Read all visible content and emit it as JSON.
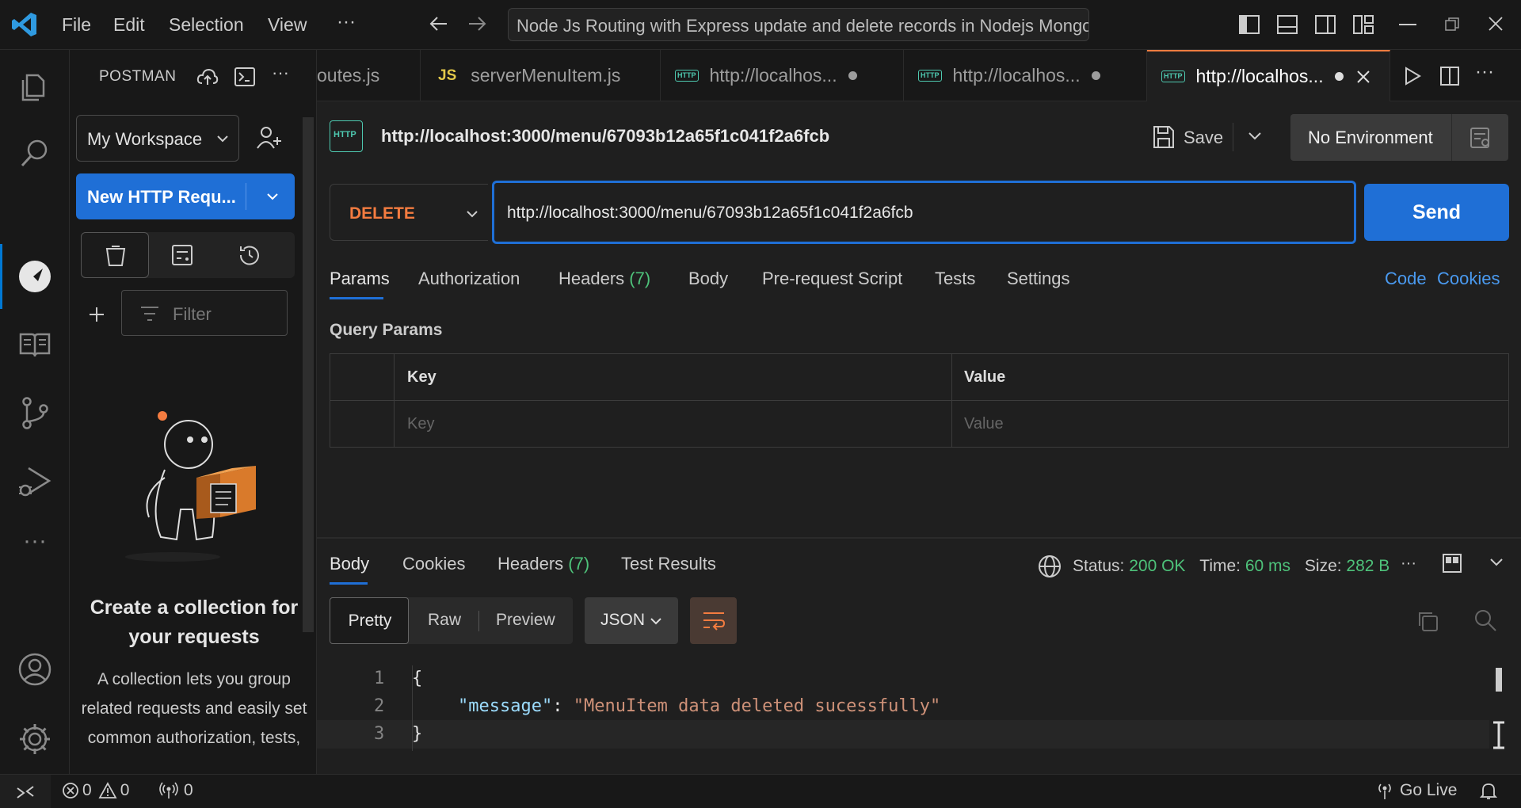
{
  "titlebar": {
    "menu": [
      "File",
      "Edit",
      "Selection",
      "View"
    ],
    "search_text": "Node Js Routing with Express update and delete records in Nodejs Mongo"
  },
  "postman": {
    "title": "POSTMAN",
    "workspace": "My Workspace",
    "new_request": "New HTTP Requ...",
    "filter_placeholder": "Filter",
    "empty_title": "Create a collection for your requests",
    "empty_body": "A collection lets you group related requests and easily set common authorization, tests,"
  },
  "tabs": [
    {
      "label": "outes.js"
    },
    {
      "label": "serverMenuItem.js",
      "lang": "JS"
    },
    {
      "label": "http://localhos..."
    },
    {
      "label": "http://localhos..."
    },
    {
      "label": "http://localhos..."
    }
  ],
  "request": {
    "title_url": "http://localhost:3000/menu/67093b12a65f1c041f2a6fcb",
    "save_label": "Save",
    "environment": "No Environment",
    "method": "DELETE",
    "url": "http://localhost:3000/menu/67093b12a65f1c041f2a6fcb",
    "send_label": "Send",
    "tabs": [
      "Params",
      "Authorization",
      "Headers",
      "Body",
      "Pre-request Script",
      "Tests",
      "Settings"
    ],
    "headers_count": "(7)",
    "code_link": "Code",
    "cookies_link": "Cookies",
    "query_params_title": "Query Params",
    "table_headers": [
      "Key",
      "Value"
    ],
    "key_placeholder": "Key",
    "value_placeholder": "Value"
  },
  "response": {
    "tabs": [
      "Body",
      "Cookies",
      "Headers",
      "Test Results"
    ],
    "headers_count": "(7)",
    "status_label": "Status:",
    "status_value": "200 OK",
    "time_label": "Time:",
    "time_value": "60 ms",
    "size_label": "Size:",
    "size_value": "282 B",
    "view_modes": [
      "Pretty",
      "Raw",
      "Preview"
    ],
    "format": "JSON",
    "code_lines": [
      {
        "num": "1",
        "text": "{"
      },
      {
        "num": "2",
        "key": "\"message\"",
        "colon": ": ",
        "value": "\"MenuItem data deleted sucessfully\""
      },
      {
        "num": "3",
        "text": "}"
      }
    ]
  },
  "statusbar": {
    "errors": "0",
    "warnings": "0",
    "ports": "0",
    "go_live": "Go Live"
  },
  "colors": {
    "accent": "#1f6fd6",
    "method": "#f47c40",
    "status_ok": "#4ec27a"
  }
}
